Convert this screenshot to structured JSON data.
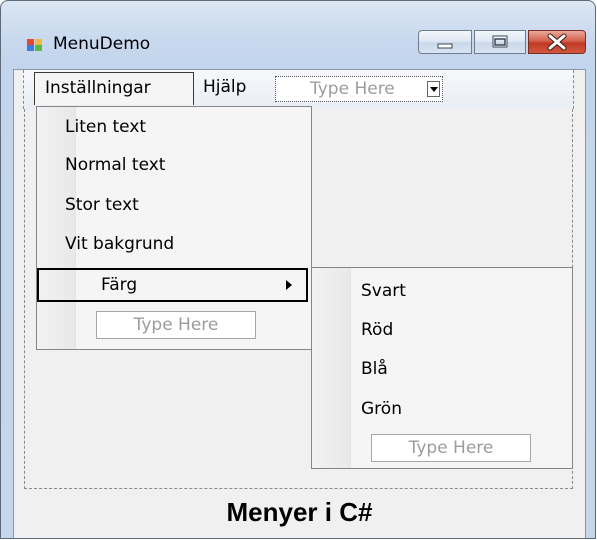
{
  "window": {
    "title": "MenuDemo",
    "icon": "winforms-app-icon"
  },
  "menubar": {
    "items": [
      {
        "label": "Inställningar"
      },
      {
        "label": "Hjälp"
      }
    ],
    "type_here": "Type Here"
  },
  "installningar_menu": {
    "items": [
      {
        "label": "Liten text"
      },
      {
        "label": "Normal text"
      },
      {
        "label": "Stor text"
      },
      {
        "label": "Vit bakgrund"
      },
      {
        "label": "Färg"
      }
    ],
    "type_here": "Type Here"
  },
  "farg_submenu": {
    "items": [
      {
        "label": "Svart"
      },
      {
        "label": "Röd"
      },
      {
        "label": "Blå"
      },
      {
        "label": "Grön"
      }
    ],
    "type_here": "Type Here"
  },
  "form": {
    "label": "Menyer i C#"
  },
  "colors": {
    "client_bg": "#f0f0f0",
    "close_button": "#c13a25",
    "placeholder_text": "#9c9c9c"
  }
}
